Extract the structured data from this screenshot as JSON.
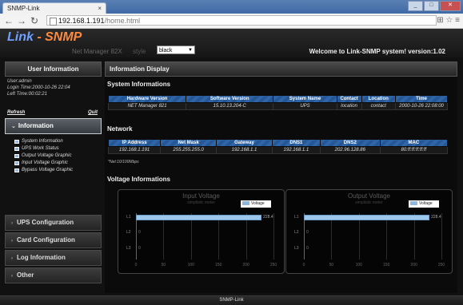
{
  "browser": {
    "tab_title": "SNMP-Link",
    "tab_close": "×",
    "url_host": "192.168.1.191",
    "url_path": "/home.html"
  },
  "header": {
    "logo_a": "Link",
    "logo_sep": " - ",
    "logo_b": "SNMP",
    "subtitle": "Net Manager 82X",
    "style_label": "style",
    "style_value": "black",
    "welcome": "Welcome to Link-SNMP system! version:1.02"
  },
  "sidebar": {
    "user_header": "User Information",
    "user_lines": [
      "User:admin",
      "Login Time:2000-10-26 22:04",
      "Left Time:00:02:21"
    ],
    "refresh": "Refresh",
    "quit": "Quit",
    "active_menu": "Information",
    "sub_items": [
      "System Information",
      "UPS Work Status",
      "Output Voltage Graphic",
      "Input Voltage Graphic",
      "Bypass Voltage Graphic"
    ],
    "menus": [
      "UPS Configuration",
      "Card Configuration",
      "Log Information",
      "Other"
    ]
  },
  "main": {
    "header": "Information Display",
    "system_title": "System Informations",
    "system_cols": [
      "Hardware Version",
      "Software Version",
      "System Name",
      "Contact",
      "Location",
      "Time"
    ],
    "system_row": [
      "NET Manager 821",
      "15.10.13.204-C",
      "UPS",
      "location",
      "contact",
      "2000-10-26 22:08:00"
    ],
    "network_title": "Network",
    "network_cols": [
      "IP Address",
      "Net Mask",
      "Gateway",
      "DNS1",
      "DNS2",
      "MAC"
    ],
    "network_row": [
      "192.168.1.191",
      "255.255.255.0",
      "192.168.1.1",
      "192.168.1.1",
      "202.96.128.86",
      "80:ff:ff:ff:ff:ff"
    ],
    "net_note": "*Net:10/100Mbps",
    "voltage_title": "Voltage Informations"
  },
  "chart_data": [
    {
      "type": "bar",
      "title": "Input Voltage",
      "subtitle": "simplistic meter",
      "categories": [
        "L1",
        "L2",
        "L3"
      ],
      "series": [
        {
          "name": "Voltage",
          "values": [
            228.4,
            0,
            0
          ]
        }
      ],
      "value_labels": [
        "228.4",
        "0",
        "0"
      ],
      "xlim": [
        0,
        250
      ],
      "xticks": [
        "0",
        "50",
        "100",
        "150",
        "200",
        "250"
      ]
    },
    {
      "type": "bar",
      "title": "Output Voltage",
      "subtitle": "simplistic meter",
      "categories": [
        "L1",
        "L2",
        "L3"
      ],
      "series": [
        {
          "name": "Voltage",
          "values": [
            228.4,
            0,
            0
          ]
        }
      ],
      "value_labels": [
        "228.4",
        "0",
        "0"
      ],
      "xlim": [
        0,
        250
      ],
      "xticks": [
        "0",
        "50",
        "100",
        "150",
        "200",
        "250"
      ]
    }
  ],
  "footer": "SNMP-Link"
}
